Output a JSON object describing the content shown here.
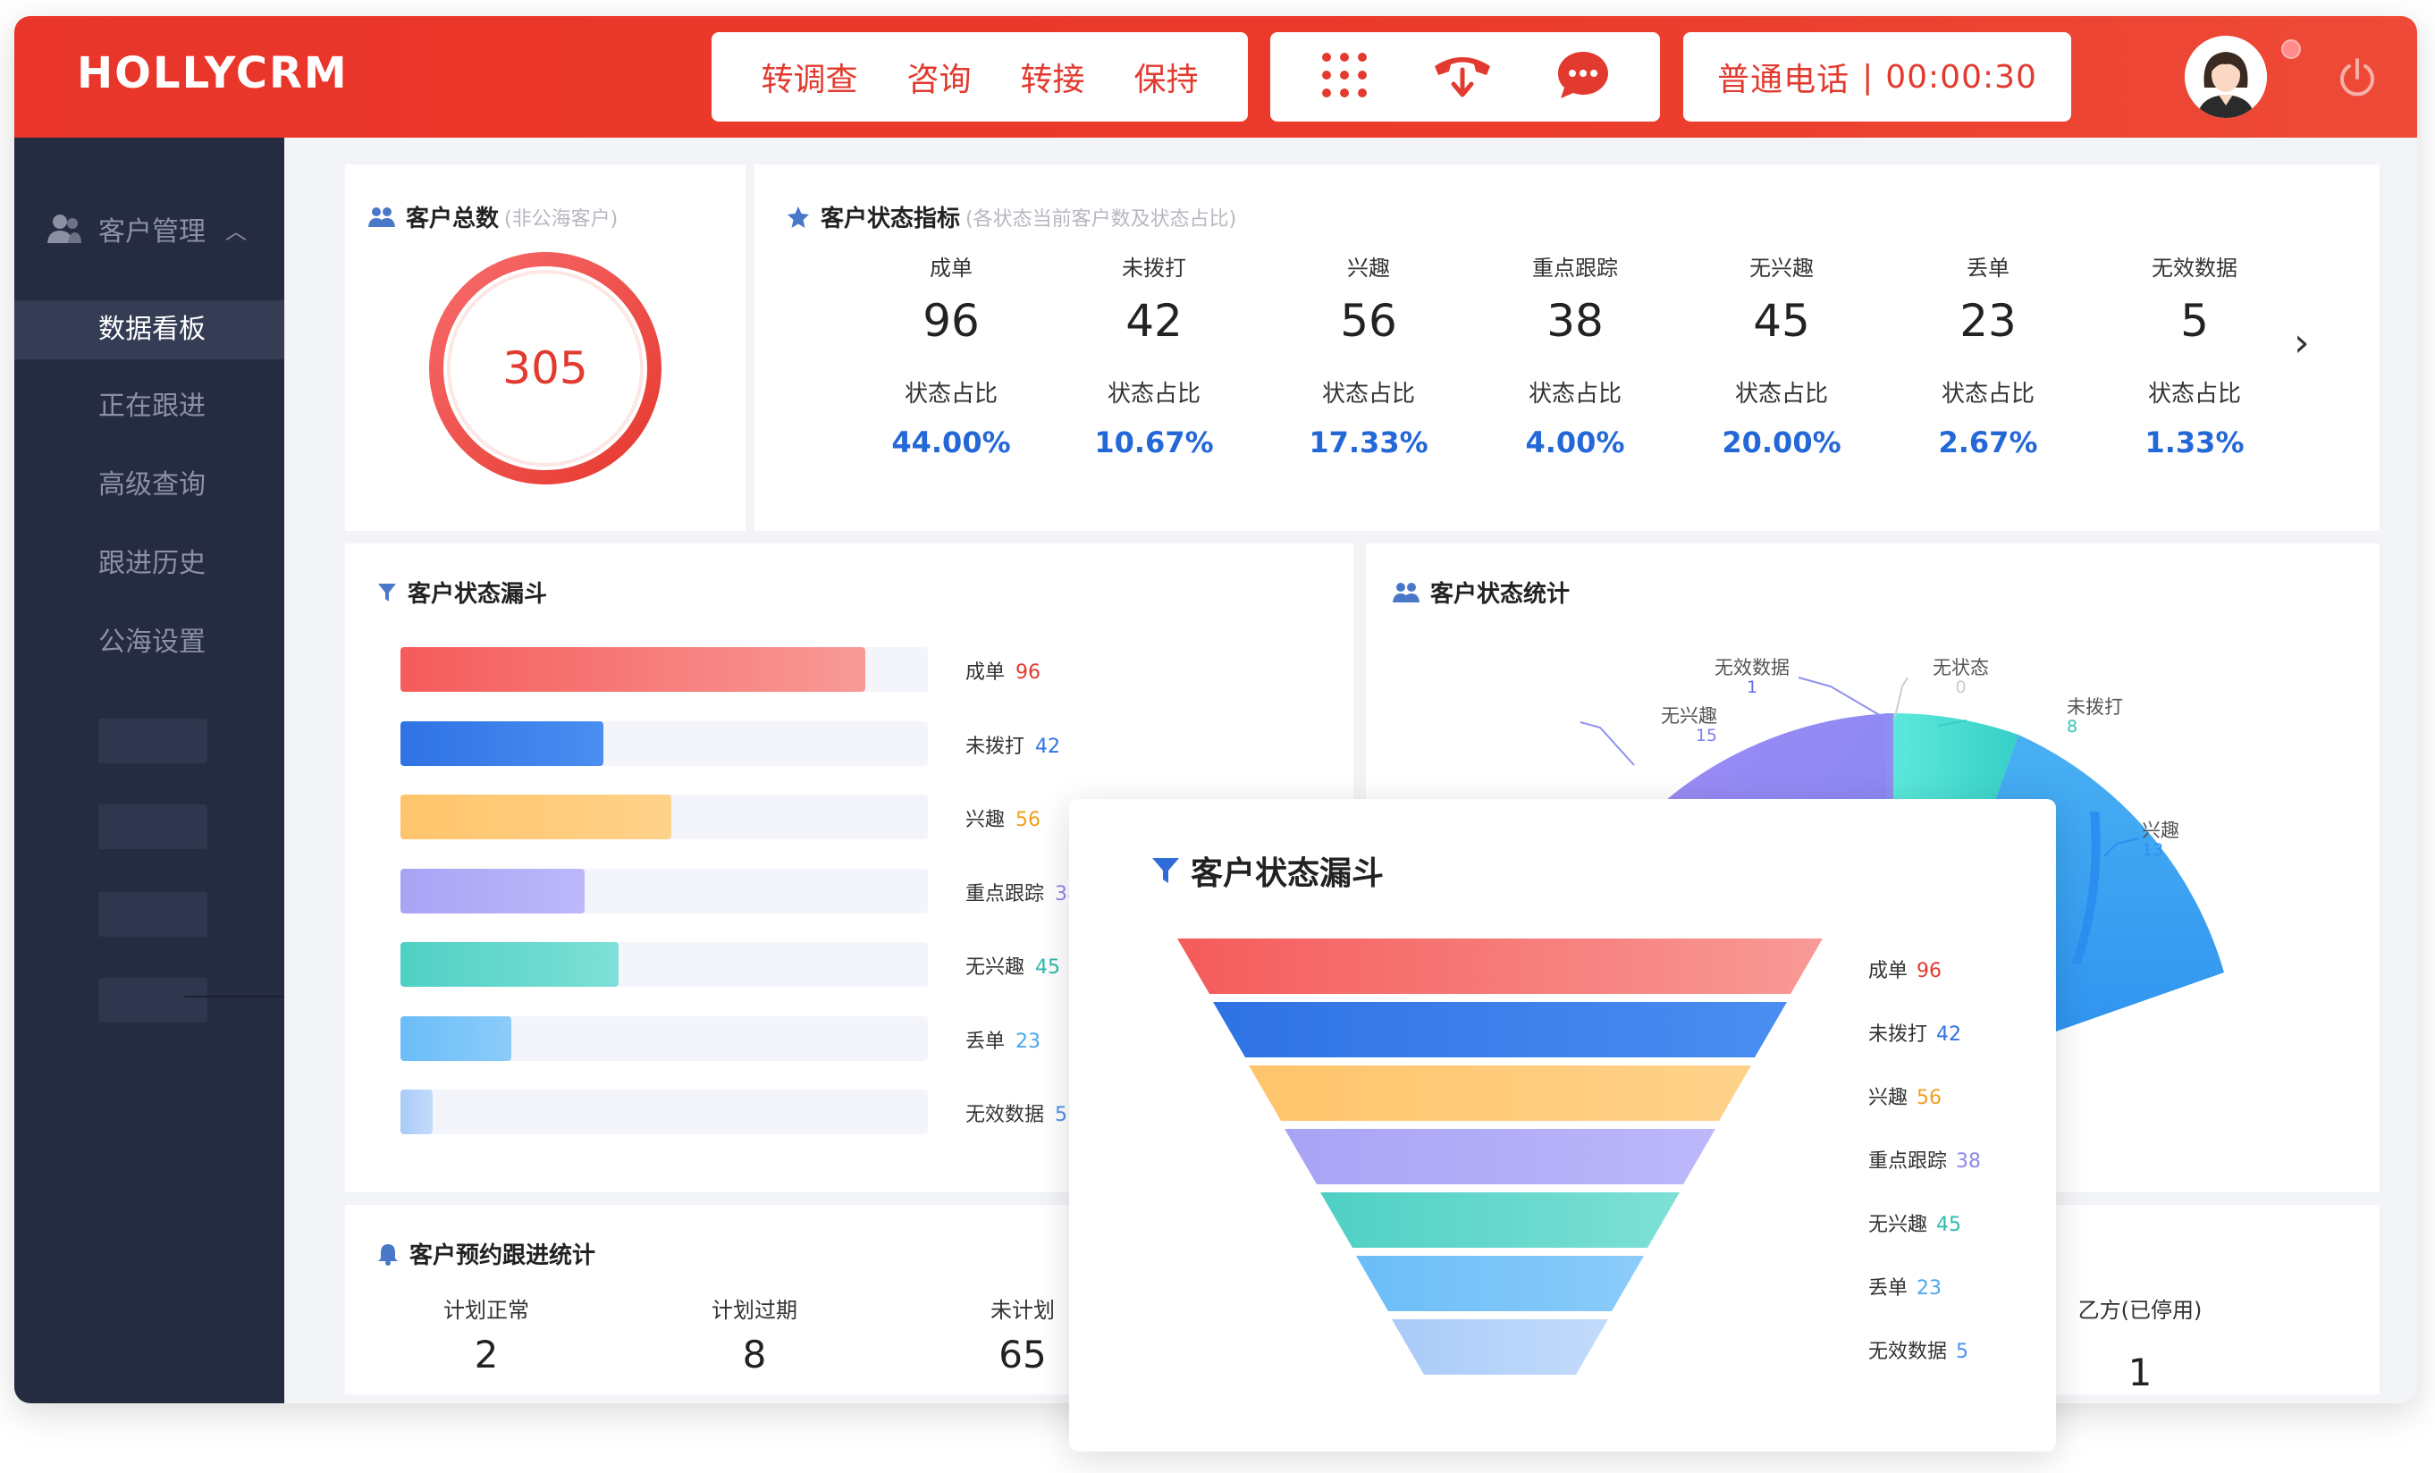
{
  "brand": "HOLLYCRM",
  "header": {
    "actions": [
      "转调查",
      "咨询",
      "转接",
      "保持"
    ],
    "call_type": "普通电话",
    "call_sep": "|",
    "call_time": "00:00:30"
  },
  "sidebar": {
    "section": "客户管理",
    "items": [
      "数据看板",
      "正在跟进",
      "高级查询",
      "跟进历史",
      "公海设置"
    ],
    "active_index": 0
  },
  "total_card": {
    "title": "客户总数",
    "subtitle": "(非公海客户)",
    "value": "305"
  },
  "indicators": {
    "title": "客户状态指标",
    "subtitle": "(各状态当前客户数及状态占比)",
    "ratio_label": "状态占比",
    "items": [
      {
        "name": "成单",
        "value": "96",
        "pct": "44.00%"
      },
      {
        "name": "未拨打",
        "value": "42",
        "pct": "10.67%"
      },
      {
        "name": "兴趣",
        "value": "56",
        "pct": "17.33%"
      },
      {
        "name": "重点跟踪",
        "value": "38",
        "pct": "4.00%"
      },
      {
        "name": "无兴趣",
        "value": "45",
        "pct": "20.00%"
      },
      {
        "name": "丢单",
        "value": "23",
        "pct": "2.67%"
      },
      {
        "name": "无效数据",
        "value": "5",
        "pct": "1.33%"
      }
    ]
  },
  "funnel_card": {
    "title": "客户状态漏斗",
    "items": [
      {
        "name": "成单",
        "value": "96",
        "color": "#f55b5b",
        "color2": "#f89a96",
        "text_color": "#e23a2f"
      },
      {
        "name": "未拨打",
        "value": "42",
        "color": "#2f72e4",
        "color2": "#4a8ef2",
        "text_color": "#2f72e4"
      },
      {
        "name": "兴趣",
        "value": "56",
        "color": "#ffc46b",
        "color2": "#ffd28a",
        "text_color": "#f0a020"
      },
      {
        "name": "重点跟踪",
        "value": "38",
        "color": "#a9a3f5",
        "color2": "#bdb8fa",
        "text_color": "#8f88ee"
      },
      {
        "name": "无兴趣",
        "value": "45",
        "color": "#4fd0c4",
        "color2": "#7ee0d6",
        "text_color": "#2cbbad"
      },
      {
        "name": "丢单",
        "value": "23",
        "color": "#6bbdf8",
        "color2": "#8bccfa",
        "text_color": "#4aa8ec"
      },
      {
        "name": "无效数据",
        "value": "5",
        "color": "#a9cbf8",
        "color2": "#c3dbfb",
        "text_color": "#4a8ef2"
      }
    ]
  },
  "pie_card": {
    "title": "客户状态统计",
    "labels": [
      {
        "name": "无效数据",
        "value": "1"
      },
      {
        "name": "无状态",
        "value": "0"
      },
      {
        "name": "未拨打",
        "value": "8"
      },
      {
        "name": "无兴趣",
        "value": "15"
      },
      {
        "name": "兴趣",
        "value": "13"
      }
    ]
  },
  "schedule_card": {
    "title": "客户预约跟进统计",
    "items": [
      {
        "name": "计划正常",
        "value": "2"
      },
      {
        "name": "计划过期",
        "value": "8"
      },
      {
        "name": "未计划",
        "value": "65"
      }
    ],
    "partial_label": "乙方(已停用)",
    "partial_value": "1"
  },
  "popup": {
    "title": "客户状态漏斗"
  },
  "colors": {
    "accent": "#e9352a",
    "sidebar_bg": "#252c42",
    "link_blue": "#2468d8"
  }
}
